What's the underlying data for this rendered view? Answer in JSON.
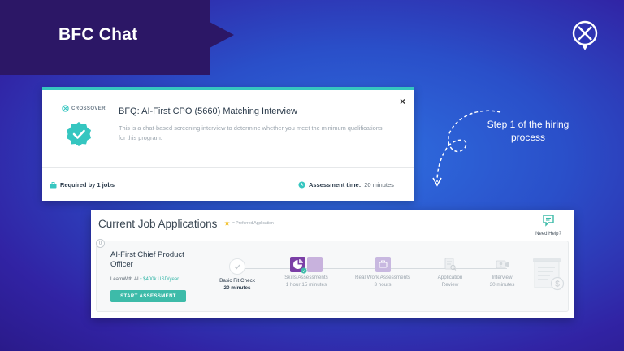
{
  "slide": {
    "title": "BFC Chat",
    "step_note": "Step 1 of the hiring process"
  },
  "assessment_card": {
    "brand": "CROSSOVER",
    "close_symbol": "×",
    "title": "BFQ: AI-First CPO (5660) Matching Interview",
    "description": "This is a chat-based screening interview to determine whether you meet the minimum qualifications for this program.",
    "required_by": "Required by 1 jobs",
    "assessment_time_label": "Assessment time:",
    "assessment_time_value": "20 minutes"
  },
  "applications": {
    "title": "Current Job Applications",
    "preferred_legend": "= Preferred Application",
    "need_help": "Need Help?",
    "row_index": "0",
    "job": {
      "title": "AI-First Chief Product Officer",
      "company": "LearnWith.AI",
      "separator": " • ",
      "salary": "$400k USD/year",
      "start_button": "START ASSESSMENT"
    },
    "steps": [
      {
        "label": "Basic Fit Check",
        "sub": "20 minutes",
        "icon": "check-icon"
      },
      {
        "label": "Skills Assessments",
        "sub": "1 hour 15 minutes",
        "icon": "skills-icon"
      },
      {
        "label": "Real Work Assessments",
        "sub": "3 hours",
        "icon": "work-icon"
      },
      {
        "label": "Application",
        "sub": "Review",
        "icon": "review-icon"
      },
      {
        "label": "Interview",
        "sub": "30 minutes",
        "icon": "interview-icon"
      }
    ]
  },
  "colors": {
    "teal": "#35c6c0",
    "button": "#3dbba9",
    "banner": "#2c1766",
    "skills_purple": "#7b3fa6"
  }
}
